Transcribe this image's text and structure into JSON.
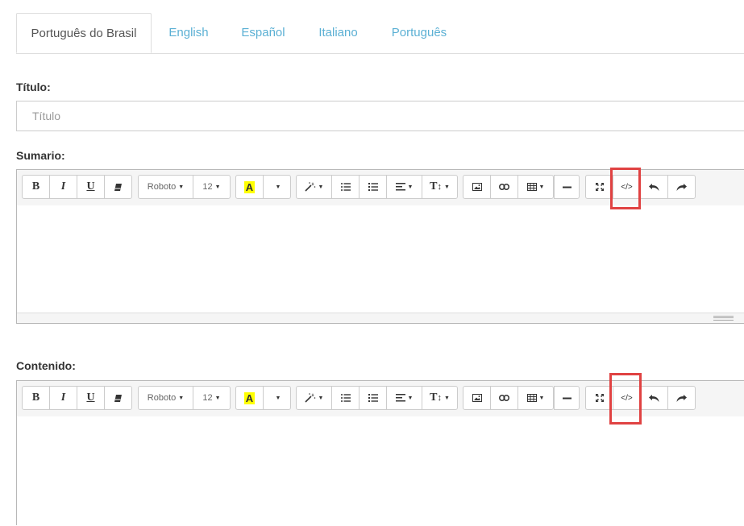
{
  "tabs": [
    {
      "label": "Português do Brasil",
      "active": true
    },
    {
      "label": "English",
      "active": false
    },
    {
      "label": "Español",
      "active": false
    },
    {
      "label": "Italiano",
      "active": false
    },
    {
      "label": "Português",
      "active": false
    }
  ],
  "titulo": {
    "label": "Título:",
    "placeholder": "Título"
  },
  "sumario": {
    "label": "Sumario:"
  },
  "contenido": {
    "label": "Contenido:"
  },
  "toolbar": {
    "bold": "B",
    "italic": "I",
    "underline": "U",
    "font_name": "Roboto",
    "font_size": "12",
    "highlight": "A",
    "code_view": "</>",
    "text_size": "T",
    "icons": [
      "eraser-icon",
      "magic-wand-icon",
      "unordered-list-icon",
      "ordered-list-icon",
      "align-icon",
      "text-height-icon",
      "picture-icon",
      "link-icon",
      "table-icon",
      "horizontal-rule-icon",
      "fullscreen-icon",
      "code-view-icon",
      "undo-icon",
      "redo-icon"
    ]
  },
  "colors": {
    "tab_link": "#5bb0d4",
    "highlight": "#ffff00",
    "annotation": "#e04242"
  }
}
